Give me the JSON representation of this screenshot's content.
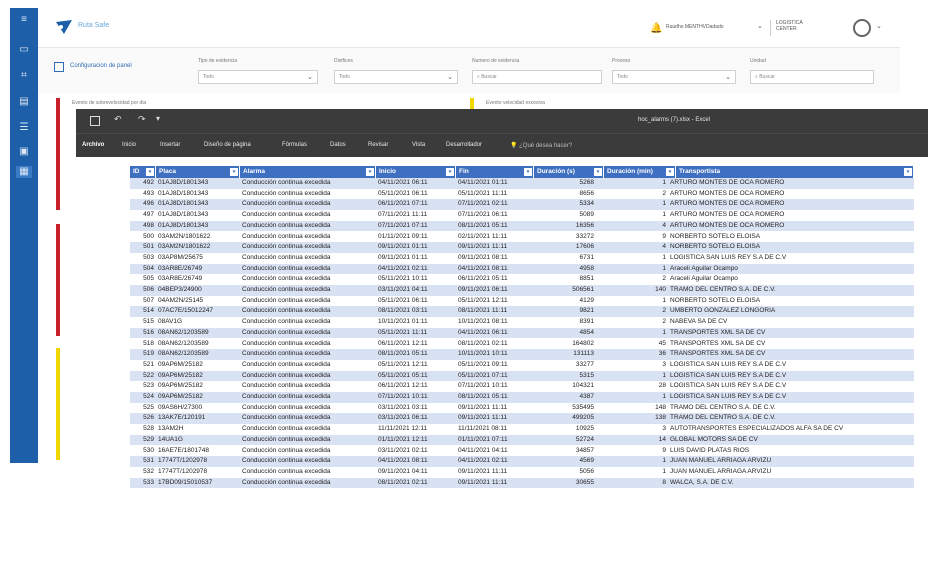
{
  "app": {
    "logo_text": "Ruta Safe",
    "user_name": "Ruudho MENTHVDadado",
    "company": [
      "LOGISTICA",
      "CENTER"
    ],
    "config_link": "Configuracion de panel",
    "filters": [
      {
        "label": "Tipo de evidencia",
        "value": "Todo"
      },
      {
        "label": "Distfices",
        "value": "Todo"
      },
      {
        "label": "Numero de evidencia",
        "value": "Buscar"
      },
      {
        "label": "Proceso",
        "value": "Todo"
      },
      {
        "label": "Unidad",
        "value": "Buscar"
      }
    ],
    "card_titles": [
      "Evento de sobrevelocidad por dia",
      "Evento velocidad excesiva"
    ]
  },
  "excel": {
    "doc_title": "hoc_alarms (7).xlsx - Excel",
    "ribbon_tabs": [
      "Archivo",
      "Inicio",
      "Insertar",
      "Diseño de página",
      "Fórmulas",
      "Datos",
      "Revisar",
      "Vista",
      "Desarrollador"
    ],
    "tell_me": "¿Qué desea hacer?",
    "table": {
      "columns": [
        "ID",
        "Placa",
        "Alarma",
        "Inicio",
        "Fin",
        "Duración (s)",
        "Duración (min)",
        "Transportista"
      ],
      "rows": [
        [
          "492",
          "01AJ8D/1801343",
          "Conducción continua excedida",
          "04/11/2021 06:11",
          "04/11/2021 01:11",
          "5268",
          "1",
          "ARTURO MONTES DE OCA ROMERO"
        ],
        [
          "493",
          "01AJ8D/1801343",
          "Conducción continua excedida",
          "05/11/2021 06:11",
          "05/11/2021 11:11",
          "8656",
          "2",
          "ARTURO MONTES DE OCA ROMERO"
        ],
        [
          "496",
          "01AJ8D/1801343",
          "Conducción continua excedida",
          "06/11/2021 07:11",
          "07/11/2021 02:11",
          "5334",
          "1",
          "ARTURO MONTES DE OCA ROMERO"
        ],
        [
          "497",
          "01AJ8D/1801343",
          "Conducción continua excedida",
          "07/11/2021 11:11",
          "07/11/2021 06:11",
          "5089",
          "1",
          "ARTURO MONTES DE OCA ROMERO"
        ],
        [
          "498",
          "01AJ8D/1801343",
          "Conducción continua excedida",
          "07/11/2021 07:11",
          "08/11/2021 05:11",
          "16356",
          "4",
          "ARTURO MONTES DE OCA ROMERO"
        ],
        [
          "500",
          "03AM2N/1801622",
          "Conducción continua excedida",
          "01/11/2021 09:11",
          "02/11/2021 11:11",
          "33272",
          "9",
          "NORBERTO SOTELO ELOISA"
        ],
        [
          "501",
          "03AM2N/1801622",
          "Conducción continua excedida",
          "09/11/2021 01:11",
          "09/11/2021 11:11",
          "17606",
          "4",
          "NORBERTO SOTELO ELOISA"
        ],
        [
          "503",
          "03AP8M/25675",
          "Conducción continua excedida",
          "09/11/2021 01:11",
          "09/11/2021 08:11",
          "6731",
          "1",
          "LOGISTICA SAN LUIS REY S.A DE C.V"
        ],
        [
          "504",
          "03AR8E/26749",
          "Conducción continua excedida",
          "04/11/2021 02:11",
          "04/11/2021 08:11",
          "4958",
          "1",
          "Araceli Aguilar Ocampo"
        ],
        [
          "505",
          "03AR8E/26749",
          "Conducción continua excedida",
          "05/11/2021 10:11",
          "06/11/2021 05:11",
          "8851",
          "2",
          "Araceli Aguilar Ocampo"
        ],
        [
          "506",
          "04BEP3/24900",
          "Conducción continua excedida",
          "03/11/2021 04:11",
          "09/11/2021 06:11",
          "506561",
          "140",
          "TRAMO DEL CENTRO S.A. DE C.V."
        ],
        [
          "507",
          "04AM2N/25145",
          "Conducción continua excedida",
          "05/11/2021 06:11",
          "05/11/2021 12:11",
          "4129",
          "1",
          "NORBERTO SOTELO ELOISA"
        ],
        [
          "514",
          "07AC7E/15012247",
          "Conducción continua excedida",
          "08/11/2021 03:11",
          "08/11/2021 11:11",
          "9821",
          "2",
          "UMBERTO GONZALEZ LONGORIA"
        ],
        [
          "515",
          "08AV1G",
          "Conducción continua excedida",
          "10/11/2021 01:11",
          "10/11/2021 08:11",
          "8391",
          "2",
          "NABEVA SA DE CV"
        ],
        [
          "516",
          "08AN62/1203589",
          "Conducción continua excedida",
          "05/11/2021 11:11",
          "04/11/2021 06:11",
          "4854",
          "1",
          "TRANSPORTES XML SA DE CV"
        ],
        [
          "518",
          "08AN62/1203589",
          "Conducción continua excedida",
          "06/11/2021 12:11",
          "08/11/2021 02:11",
          "164802",
          "45",
          "TRANSPORTES XML SA DE CV"
        ],
        [
          "519",
          "08AN62/1203589",
          "Conducción continua excedida",
          "08/11/2021 05:11",
          "10/11/2021 10:11",
          "131113",
          "36",
          "TRANSPORTES XML SA DE CV"
        ],
        [
          "521",
          "09AP6M/25182",
          "Conducción continua excedida",
          "05/11/2021 12:11",
          "05/11/2021 09:11",
          "33277",
          "3",
          "LOGISTICA SAN LUIS REY S.A DE C.V"
        ],
        [
          "522",
          "09AP6M/25182",
          "Conducción continua excedida",
          "05/11/2021 05:11",
          "05/11/2021 07:11",
          "5315",
          "1",
          "LOGISTICA SAN LUIS REY S.A DE C.V"
        ],
        [
          "523",
          "09AP6M/25182",
          "Conducción continua excedida",
          "06/11/2021 12:11",
          "07/11/2021 10:11",
          "104321",
          "28",
          "LOGISTICA SAN LUIS REY S.A DE C.V"
        ],
        [
          "524",
          "09AP6M/25182",
          "Conducción continua excedida",
          "07/11/2021 10:11",
          "08/11/2021 05:11",
          "4387",
          "1",
          "LOGISTICA SAN LUIS REY S.A DE C.V"
        ],
        [
          "525",
          "09AS6H/27300",
          "Conducción continua excedida",
          "03/11/2021 03:11",
          "09/11/2021 11:11",
          "535495",
          "148",
          "TRAMO DEL CENTRO S.A. DE C.V."
        ],
        [
          "526",
          "13AK7E/120191",
          "Conducción continua excedida",
          "03/11/2021 06:11",
          "09/11/2021 11:11",
          "499205",
          "138",
          "TRAMO DEL CENTRO S.A. DE C.V."
        ],
        [
          "528",
          "13AM2H",
          "Conducción continua excedida",
          "11/11/2021 12:11",
          "11/11/2021 08:11",
          "10925",
          "3",
          "AUTOTRANSPORTES ESPECIALIZADOS ALFA SA DE CV"
        ],
        [
          "529",
          "14UA1G",
          "Conducción continua excedida",
          "01/11/2021 12:11",
          "01/11/2021 07:11",
          "52724",
          "14",
          "GLOBAL MOTORS SA DE CV"
        ],
        [
          "530",
          "16AE7E/1801748",
          "Conducción continua excedida",
          "03/11/2021 02:11",
          "04/11/2021 04:11",
          "34857",
          "9",
          "LUIS DAVID PLATAS RIOS"
        ],
        [
          "531",
          "17747T/1202978",
          "Conducción continua excedida",
          "04/11/2021 08:11",
          "04/11/2021 02:11",
          "4569",
          "1",
          "JUAN MANUEL ARRIAGA ARVIZU"
        ],
        [
          "532",
          "17747T/1202978",
          "Conducción continua excedida",
          "09/11/2021 04:11",
          "09/11/2021 11:11",
          "5056",
          "1",
          "JUAN MANUEL ARRIAGA ARVIZU"
        ],
        [
          "533",
          "17BD09/15010537",
          "Conducción continua excedida",
          "08/11/2021 02:11",
          "09/11/2021 11:11",
          "30655",
          "8",
          "WALCA, S.A. DE C.V."
        ]
      ]
    }
  }
}
